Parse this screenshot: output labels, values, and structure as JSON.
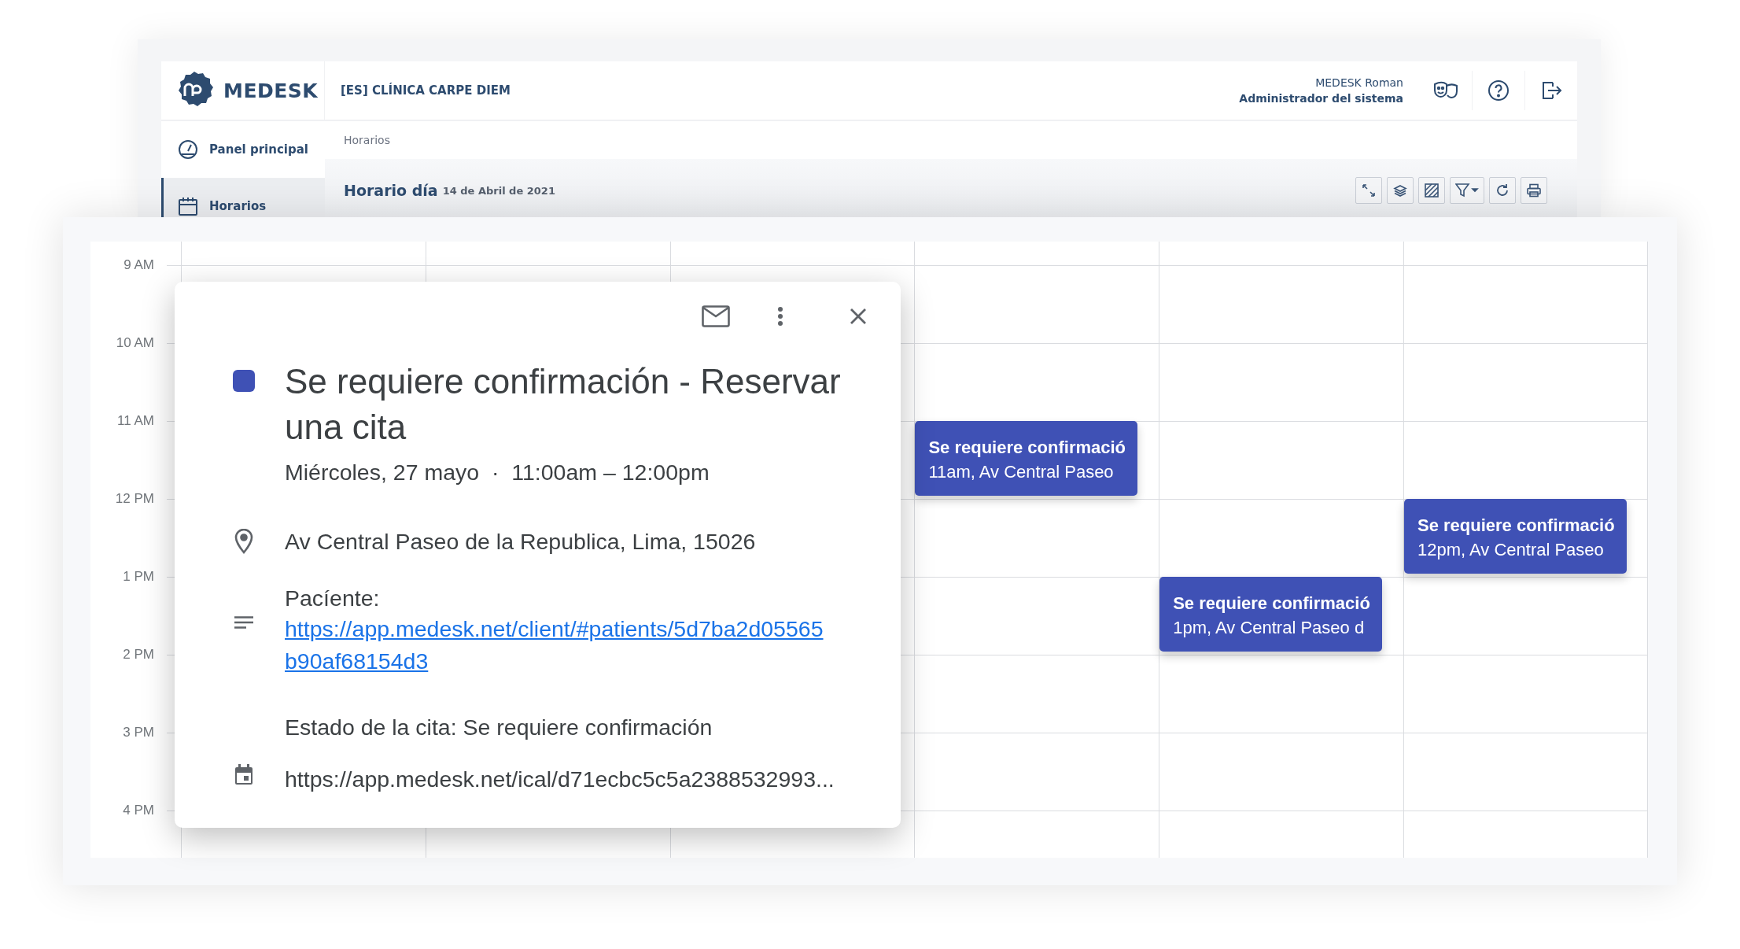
{
  "back_window": {
    "brand": "MEDESK",
    "clinic": "[ES] CLÍNICA CARPE DIEM",
    "user": {
      "name": "MEDESK Roman",
      "role": "Administrador del sistema"
    },
    "header_icons": [
      {
        "kind": "masks"
      },
      {
        "kind": "help"
      },
      {
        "kind": "logout"
      }
    ],
    "sidebar": [
      {
        "label": "Panel principal",
        "selected": false
      },
      {
        "label": "Horarios",
        "selected": true
      }
    ],
    "breadcrumb": "Horarios",
    "page_title": "Horario día",
    "page_date": "14 de Abril de 2021",
    "toolbar": [
      {
        "kind": "expand"
      },
      {
        "kind": "layers"
      },
      {
        "kind": "hatch"
      },
      {
        "kind": "filter"
      },
      {
        "kind": "refresh"
      },
      {
        "kind": "print"
      }
    ]
  },
  "calendar": {
    "times": [
      "9 AM",
      "10 AM",
      "11 AM",
      "12 PM",
      "1 PM",
      "2 PM",
      "3 PM",
      "4 PM"
    ],
    "events": [
      {
        "title": "Se requiere confirmació",
        "subtitle": "11am, Av Central Paseo"
      },
      {
        "title": "Se requiere confirmació",
        "subtitle": "12pm, Av Central Paseo"
      },
      {
        "title": "Se requiere confirmació",
        "subtitle": "1pm, Av Central Paseo d"
      }
    ]
  },
  "popup": {
    "title": "Se requiere confirmación - Reservar una cita",
    "when": "Miércoles, 27 mayo  ·  11:00am – 12:00pm",
    "location": "Av Central Paseo de la Republica, Lima, 15026",
    "description_label": "Pacíente:",
    "link": "https://app.medesk.net/client/#patients/5d7ba2d05565b90af68154d3",
    "status": "Estado de la cita: Se requiere confirmación",
    "ical": "https://app.medesk.net/ical/d71ecbc5c5a2388532993..."
  }
}
